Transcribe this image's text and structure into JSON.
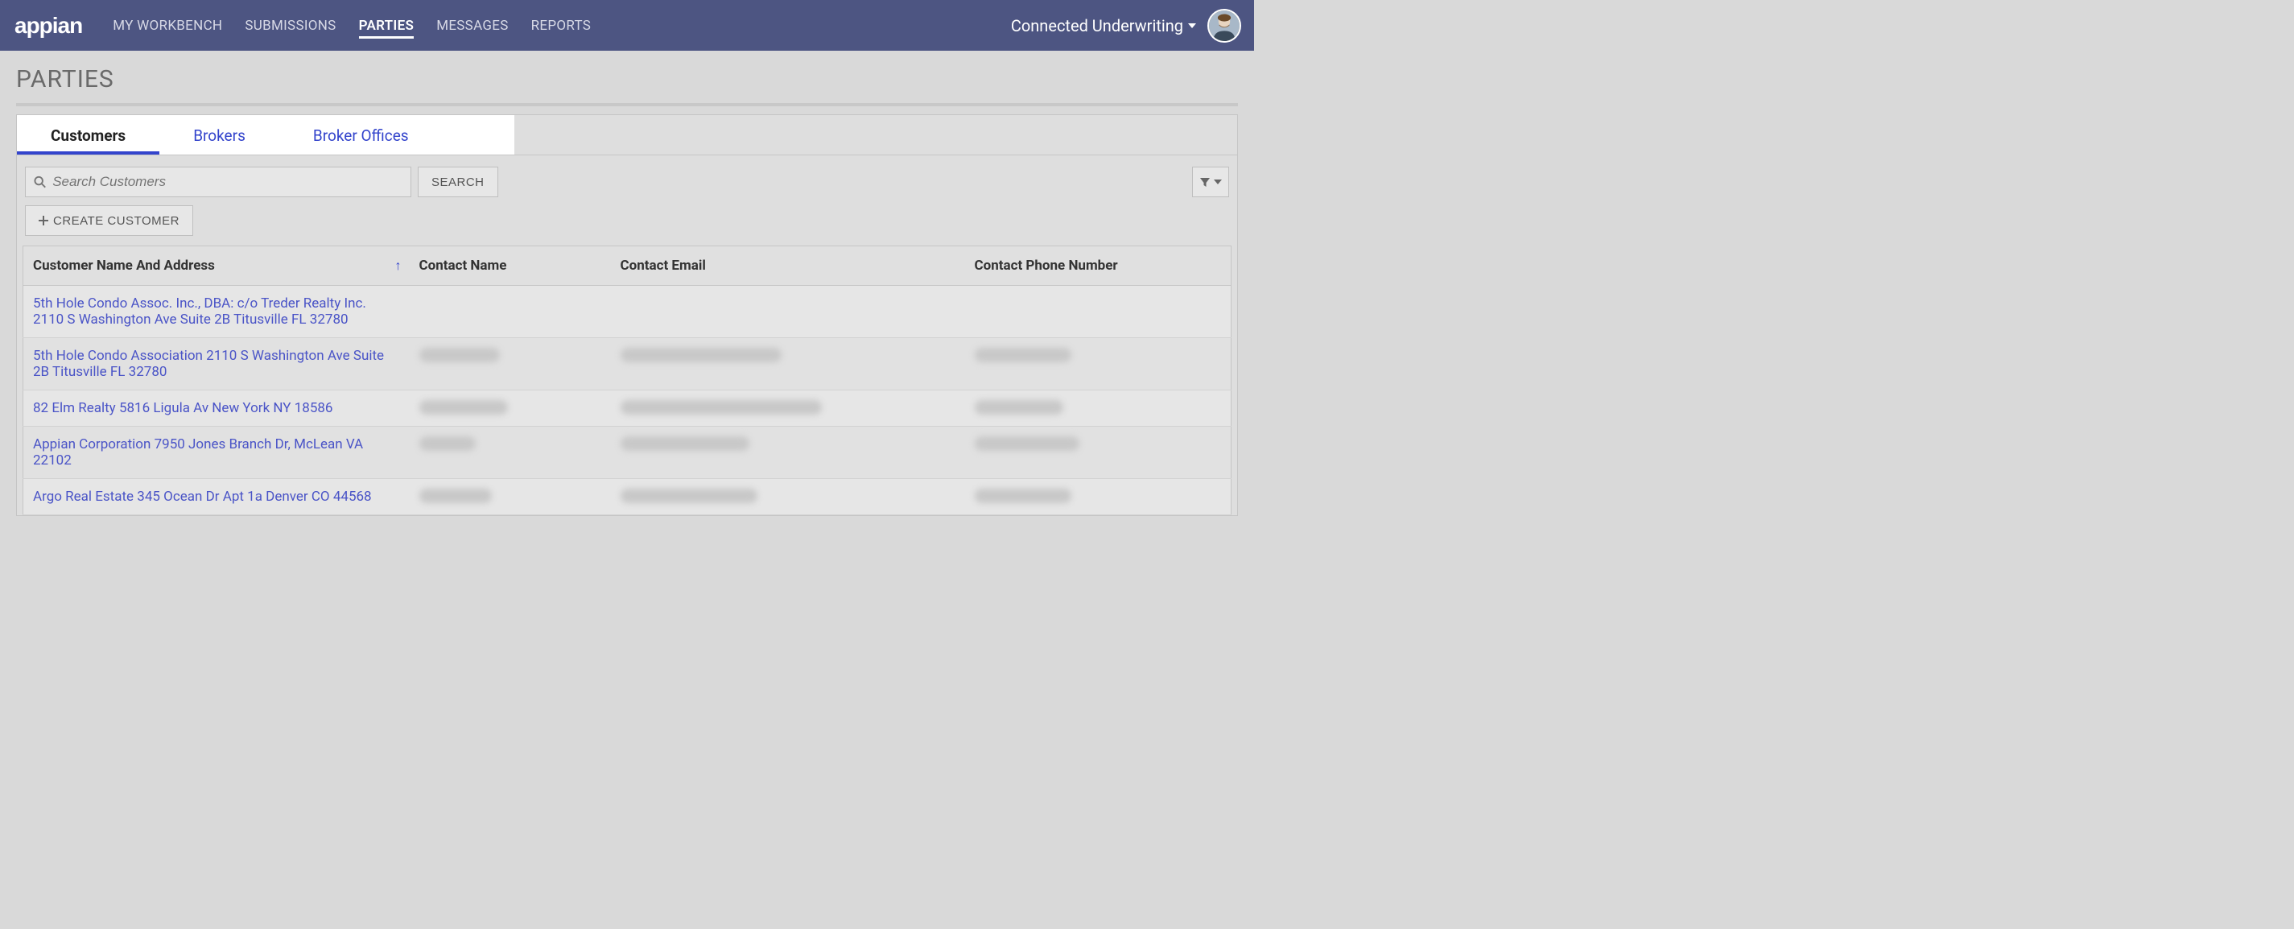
{
  "header": {
    "logo": "appian",
    "nav": [
      "MY WORKBENCH",
      "SUBMISSIONS",
      "PARTIES",
      "MESSAGES",
      "REPORTS"
    ],
    "active_nav_index": 2,
    "app_title": "Connected Underwriting"
  },
  "page": {
    "title": "PARTIES"
  },
  "tabs": {
    "items": [
      "Customers",
      "Brokers",
      "Broker Offices"
    ],
    "active_index": 0
  },
  "search": {
    "placeholder": "Search Customers",
    "button": "SEARCH"
  },
  "actions": {
    "create": "CREATE CUSTOMER"
  },
  "table": {
    "columns": [
      "Customer Name And Address",
      "Contact Name",
      "Contact Email",
      "Contact Phone Number"
    ],
    "sort_column_index": 0,
    "sort_direction": "asc",
    "rows": [
      {
        "name": "5th Hole Condo Assoc. Inc., DBA: c/o Treder Realty Inc. 2110 S Washington Ave Suite 2B Titusville FL 32780",
        "contact": "",
        "email": "",
        "phone": ""
      },
      {
        "name": "5th Hole Condo Association 2110 S Washington Ave Suite 2B Titusville FL 32780",
        "contact": "[redacted]",
        "email": "[redacted]",
        "phone": "[redacted]"
      },
      {
        "name": "82 Elm Realty 5816 Ligula Av New York NY 18586",
        "contact": "[redacted]",
        "email": "[redacted]",
        "phone": "[redacted]"
      },
      {
        "name": "Appian Corporation 7950 Jones Branch Dr, McLean VA 22102",
        "contact": "[redacted]",
        "email": "[redacted]",
        "phone": "[redacted]"
      },
      {
        "name": "Argo Real Estate 345 Ocean Dr Apt 1a Denver CO 44568",
        "contact": "[redacted]",
        "email": "[redacted]",
        "phone": "[redacted]"
      }
    ]
  }
}
